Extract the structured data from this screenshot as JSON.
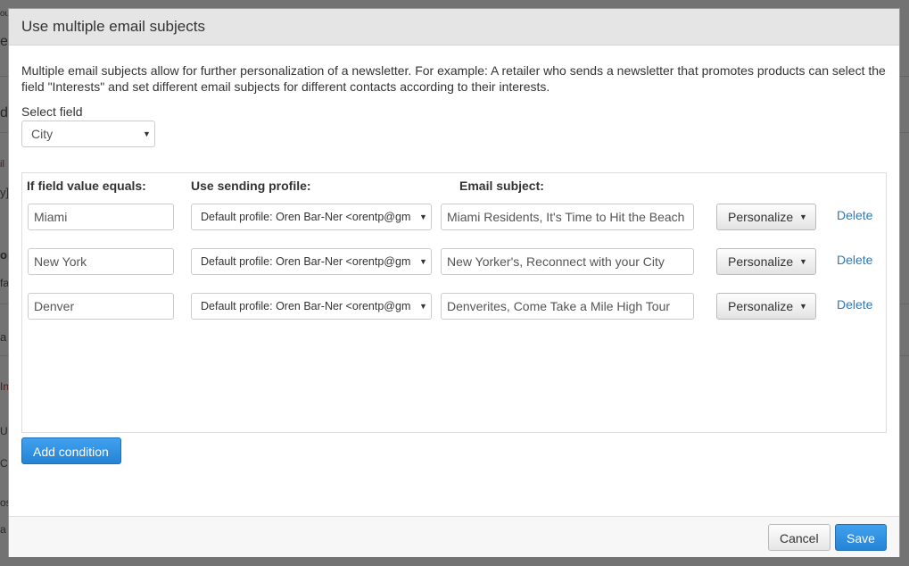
{
  "background": {
    "fragments": [
      "ou",
      "e",
      "d",
      "il",
      "y]",
      "or",
      "fa",
      "a",
      "In",
      "U",
      "C",
      "os",
      "a"
    ]
  },
  "dialog": {
    "title": "Use multiple email subjects",
    "description": "Multiple email subjects allow for further personalization of a newsletter. For example: A retailer who sends a newsletter that promotes products can select the field \"Interests\" and set different email subjects for different contacts according to their interests.",
    "select_field": {
      "label": "Select field",
      "value": "City",
      "caret_icon": "caret-down-icon"
    },
    "columns": {
      "field_value": "If field value equals:",
      "sending_profile": "Use sending profile:",
      "email_subject": "Email subject:"
    },
    "conditions": [
      {
        "value": "Miami",
        "profile": "Default profile: Oren Bar-Ner <orentp@gmail.com>",
        "subject": "Miami Residents, It's Time to Hit the Beach",
        "personalize_label": "Personalize",
        "delete_label": "Delete"
      },
      {
        "value": "New York",
        "profile": "Default profile: Oren Bar-Ner <orentp@gmail.com>",
        "subject": "New Yorker's, Reconnect with your City",
        "personalize_label": "Personalize",
        "delete_label": "Delete"
      },
      {
        "value": "Denver",
        "profile": "Default profile: Oren Bar-Ner <orentp@gmail.com>",
        "subject": "Denverites, Come Take a Mile High Tour",
        "personalize_label": "Personalize",
        "delete_label": "Delete"
      }
    ],
    "add_condition_label": "Add condition",
    "footer": {
      "cancel_label": "Cancel",
      "save_label": "Save"
    }
  },
  "colors": {
    "primary_button": "#2683d6",
    "link": "#2a7ab8",
    "header_bg": "#e5e5e5"
  }
}
